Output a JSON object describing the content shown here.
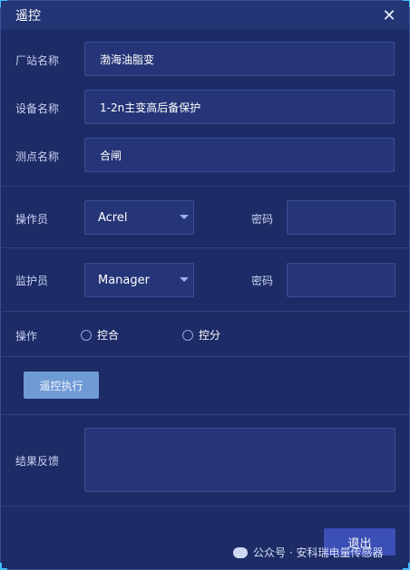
{
  "window": {
    "title": "遥控",
    "close_icon": "close-icon"
  },
  "station": {
    "label": "厂站名称",
    "value": "渤海油脂变"
  },
  "device": {
    "label": "设备名称",
    "value": "1-2n主变高后备保护"
  },
  "point": {
    "label": "测点名称",
    "value": "合闸"
  },
  "operator": {
    "label": "操作员",
    "selected": "Acrel",
    "password_label": "密码",
    "password_value": ""
  },
  "supervisor": {
    "label": "监护员",
    "selected": "Manager",
    "password_label": "密码",
    "password_value": ""
  },
  "operation": {
    "label": "操作",
    "options": [
      {
        "label": "控合",
        "checked": false
      },
      {
        "label": "控分",
        "checked": false
      }
    ]
  },
  "buttons": {
    "execute": "遥控执行",
    "exit": "退出"
  },
  "result": {
    "label": "结果反馈",
    "value": ""
  },
  "watermark": {
    "text": "公众号 · 安科瑞电量传感器"
  },
  "colors": {
    "background": "#1d2b66",
    "titlebar": "#233575",
    "accent": "#41c0ff",
    "field": "#253577"
  }
}
